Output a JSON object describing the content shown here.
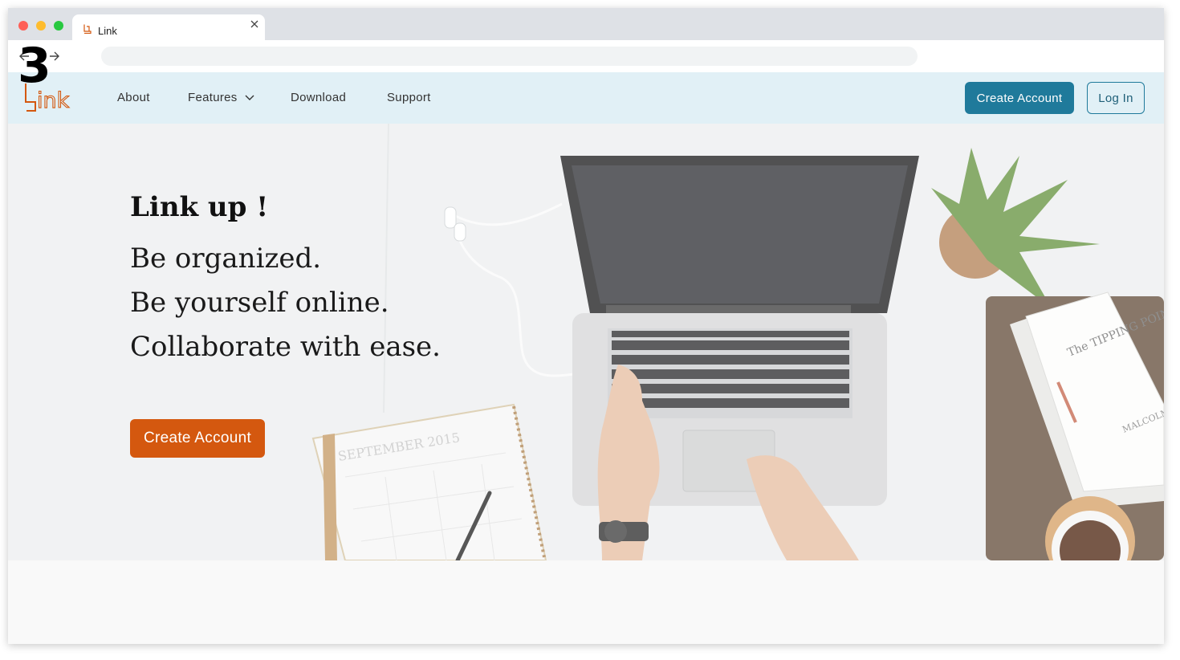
{
  "browser": {
    "tab_title": "Link",
    "colors": {
      "chrome": "#dee1e6",
      "address_bar": "#f1f3f4"
    }
  },
  "step_marker": "3",
  "header": {
    "logo_text": "Link",
    "nav": [
      "About",
      "Features",
      "Download",
      "Support"
    ],
    "create_account_label": "Create Account",
    "login_label": "Log In",
    "colors": {
      "background": "#e1f0f6",
      "primary": "#1f7a9b",
      "brand": "#d4580f"
    }
  },
  "hero": {
    "tagline": "Link up !",
    "lines": [
      "Be organized.",
      "Be yourself online.",
      "Collaborate with ease."
    ],
    "cta_label": "Create Account",
    "calendar_label": "SEPTEMBER 2015",
    "book_title": "The TIPPING POINT",
    "book_author": "MALCOLM GLADWELL",
    "colors": {
      "cta": "#d4580f"
    }
  },
  "icons": {
    "tab_favicon": "link-logo-icon",
    "tab_close": "close-icon",
    "back": "arrow-left-icon",
    "forward": "arrow-right-icon",
    "features_dropdown": "chevron-down-icon"
  }
}
